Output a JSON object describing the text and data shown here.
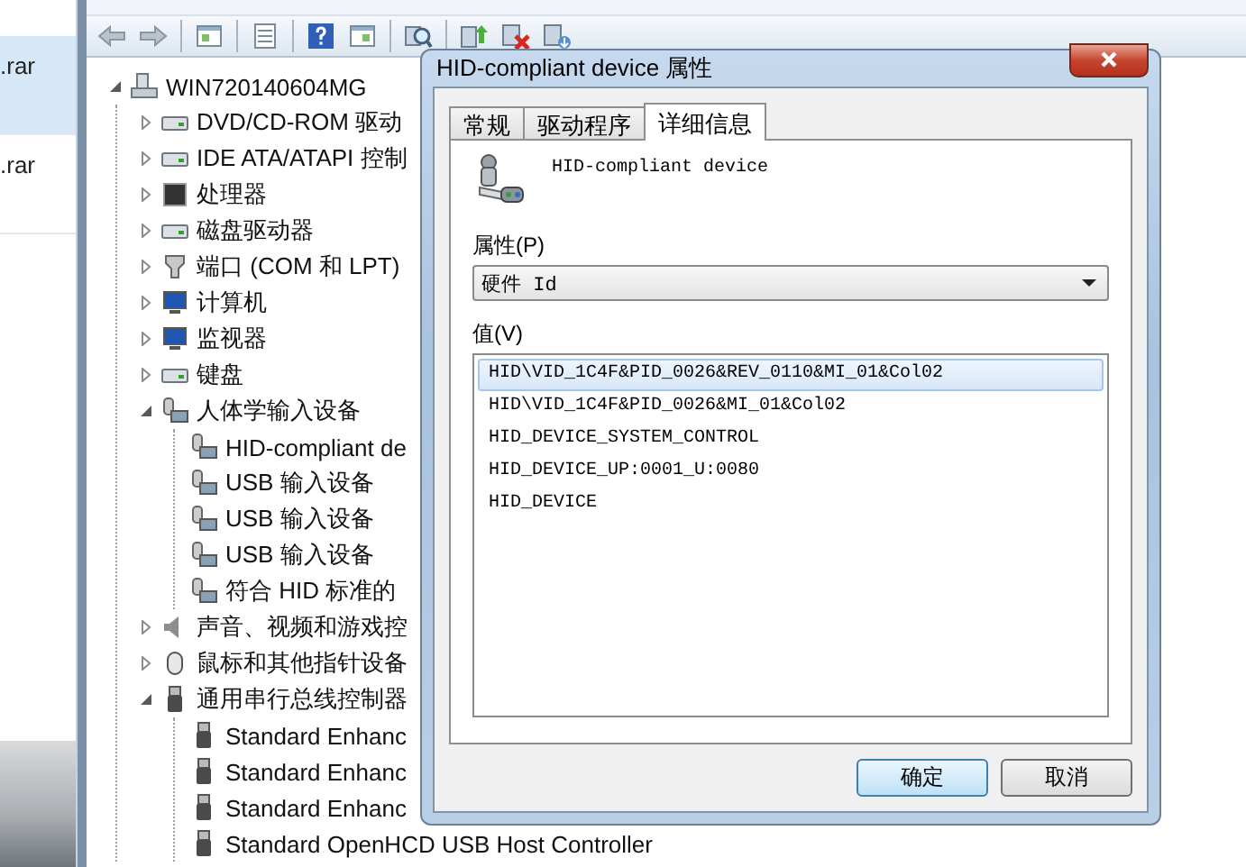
{
  "file_list": [
    {
      "name": ".rar",
      "selected": true
    },
    {
      "name": ".rar",
      "selected": false
    }
  ],
  "device_manager": {
    "tree": {
      "label": "WIN720140604MG",
      "expanded": true,
      "children": [
        {
          "label": "DVD/CD-ROM 驱动",
          "expanded": false
        },
        {
          "label": "IDE ATA/ATAPI 控制",
          "expanded": false
        },
        {
          "label": "处理器",
          "expanded": false
        },
        {
          "label": "磁盘驱动器",
          "expanded": false
        },
        {
          "label": "端口 (COM 和 LPT)",
          "expanded": false
        },
        {
          "label": "计算机",
          "expanded": false
        },
        {
          "label": "监视器",
          "expanded": false
        },
        {
          "label": "键盘",
          "expanded": false
        },
        {
          "label": "人体学输入设备",
          "expanded": true,
          "children": [
            {
              "label": "HID-compliant de"
            },
            {
              "label": "USB 输入设备"
            },
            {
              "label": "USB 输入设备"
            },
            {
              "label": "USB 输入设备"
            },
            {
              "label": "符合 HID 标准的"
            }
          ]
        },
        {
          "label": "声音、视频和游戏控",
          "expanded": false
        },
        {
          "label": "鼠标和其他指针设备",
          "expanded": false
        },
        {
          "label": "通用串行总线控制器",
          "expanded": true,
          "children": [
            {
              "label": "Standard Enhanc"
            },
            {
              "label": "Standard Enhanc"
            },
            {
              "label": "Standard Enhanc"
            },
            {
              "label": "Standard OpenHCD USB Host Controller"
            }
          ]
        }
      ]
    }
  },
  "dialog": {
    "title": "HID-compliant device 属性",
    "tabs": [
      {
        "label": "常规",
        "selected": false
      },
      {
        "label": "驱动程序",
        "selected": false
      },
      {
        "label": "详细信息",
        "selected": true
      }
    ],
    "device_name": "HID-compliant device",
    "property_label": "属性(P)",
    "property_value": "硬件 Id",
    "value_label": "值(V)",
    "values": [
      {
        "text": "HID\\VID_1C4F&PID_0026&REV_0110&MI_01&Col02",
        "selected": true
      },
      {
        "text": "HID\\VID_1C4F&PID_0026&MI_01&Col02",
        "selected": false
      },
      {
        "text": "HID_DEVICE_SYSTEM_CONTROL",
        "selected": false
      },
      {
        "text": "HID_DEVICE_UP:0001_U:0080",
        "selected": false
      },
      {
        "text": "HID_DEVICE",
        "selected": false
      }
    ],
    "buttons": [
      {
        "label": "确定",
        "default": true
      },
      {
        "label": "取消",
        "default": false
      }
    ]
  }
}
